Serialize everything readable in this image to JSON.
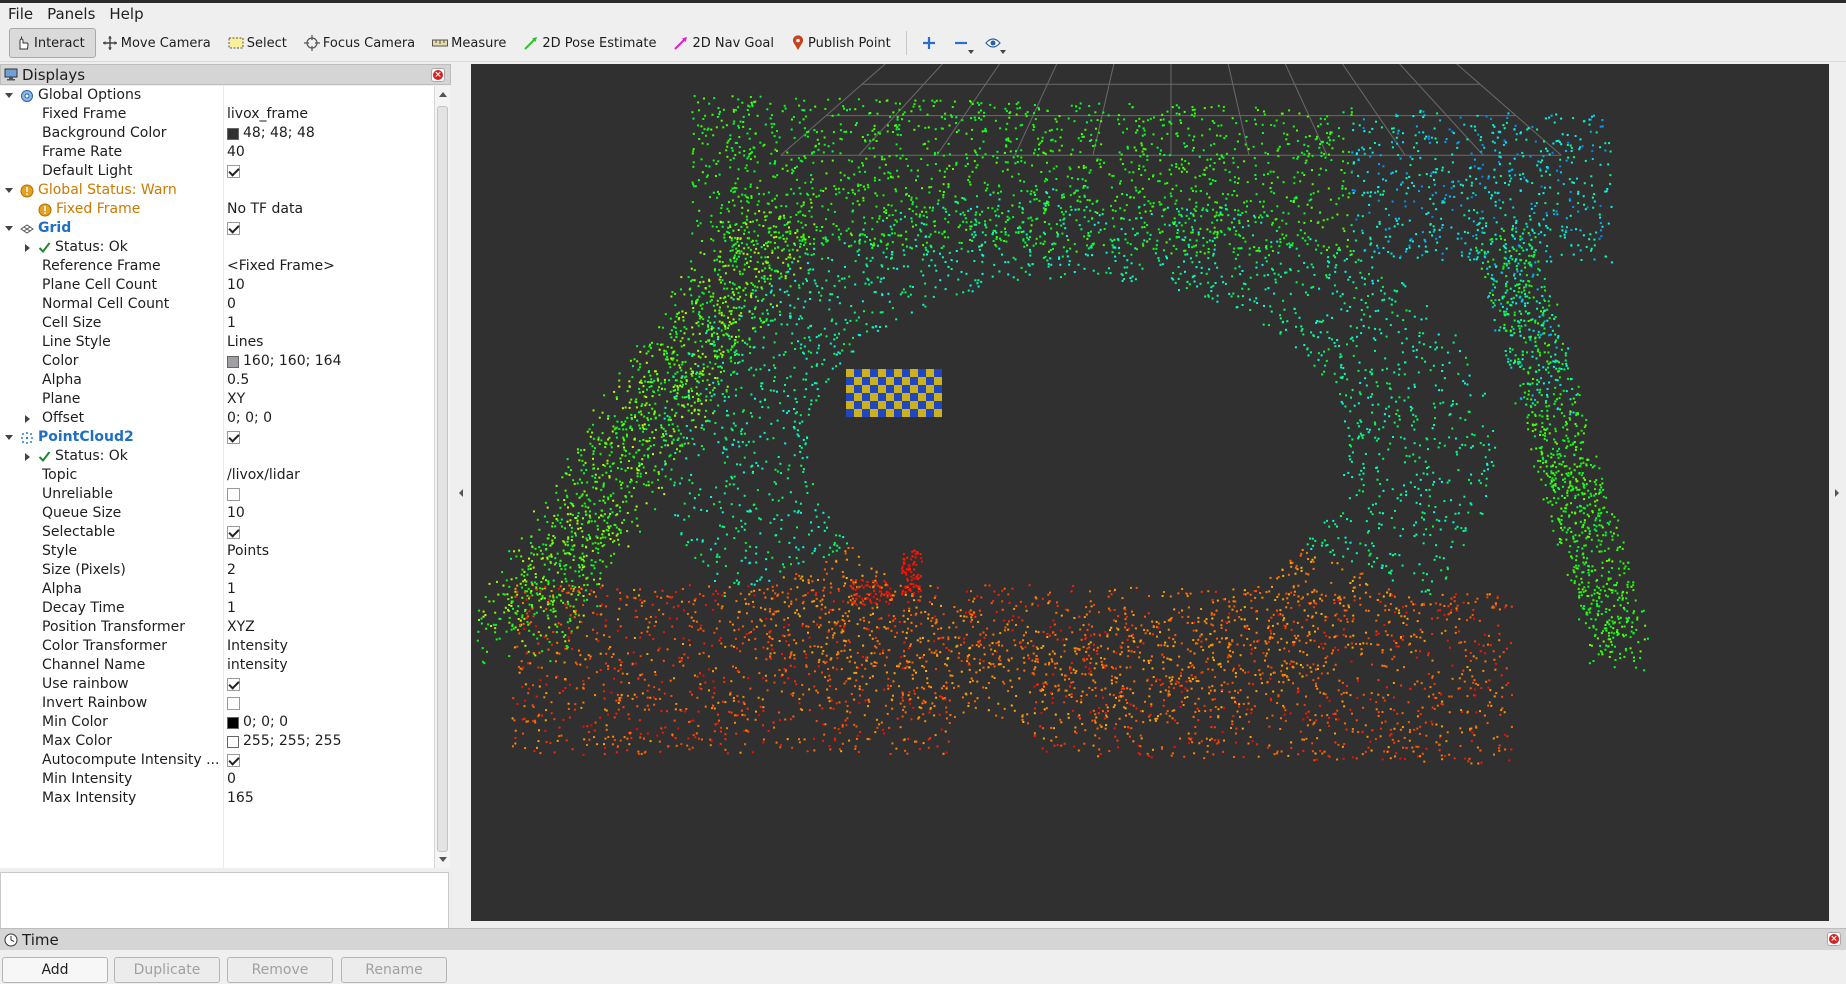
{
  "menubar": {
    "items": [
      "File",
      "Panels",
      "Help"
    ]
  },
  "toolbar": {
    "tools": [
      "Interact",
      "Move Camera",
      "Select",
      "Focus Camera",
      "Measure",
      "2D Pose Estimate",
      "2D Nav Goal",
      "Publish Point"
    ],
    "active": "Interact",
    "extra_icons": [
      "add-icon",
      "remove-icon",
      "eye-icon"
    ]
  },
  "displays_panel": {
    "title": "Displays",
    "rows": [
      {
        "depth": 0,
        "expand": "open",
        "icon": "globe-gear-icon",
        "name": "Global Options",
        "value": "",
        "style": "normal"
      },
      {
        "depth": 1,
        "name": "Fixed Frame",
        "value": "livox_frame"
      },
      {
        "depth": 1,
        "name": "Background Color",
        "value": "48; 48; 48",
        "swatch": "#303030"
      },
      {
        "depth": 1,
        "name": "Frame Rate",
        "value": "40"
      },
      {
        "depth": 1,
        "name": "Default Light",
        "check": true
      },
      {
        "depth": 0,
        "expand": "open",
        "icon": "warning-icon",
        "name": "Global Status: Warn",
        "value": "",
        "style": "warn"
      },
      {
        "depth": 1,
        "icon": "warning-icon",
        "name": "Fixed Frame",
        "value": "No TF data",
        "style": "warn"
      },
      {
        "depth": 0,
        "expand": "open",
        "icon": "grid-icon",
        "name": "Grid",
        "check": true,
        "style": "cat"
      },
      {
        "depth": 1,
        "expand": "closed",
        "icon": "ok-check-icon",
        "name": "Status: Ok",
        "value": ""
      },
      {
        "depth": 1,
        "name": "Reference Frame",
        "value": "<Fixed Frame>"
      },
      {
        "depth": 1,
        "name": "Plane Cell Count",
        "value": "10"
      },
      {
        "depth": 1,
        "name": "Normal Cell Count",
        "value": "0"
      },
      {
        "depth": 1,
        "name": "Cell Size",
        "value": "1"
      },
      {
        "depth": 1,
        "name": "Line Style",
        "value": "Lines"
      },
      {
        "depth": 1,
        "name": "Color",
        "value": "160; 160; 164",
        "swatch": "#a0a0a4"
      },
      {
        "depth": 1,
        "name": "Alpha",
        "value": "0.5"
      },
      {
        "depth": 1,
        "name": "Plane",
        "value": "XY"
      },
      {
        "depth": 1,
        "expand": "closed",
        "name": "Offset",
        "value": "0; 0; 0"
      },
      {
        "depth": 0,
        "expand": "open",
        "icon": "pointcloud-icon",
        "name": "PointCloud2",
        "check": true,
        "style": "cat"
      },
      {
        "depth": 1,
        "expand": "closed",
        "icon": "ok-check-icon",
        "name": "Status: Ok",
        "value": ""
      },
      {
        "depth": 1,
        "name": "Topic",
        "value": "/livox/lidar"
      },
      {
        "depth": 1,
        "name": "Unreliable",
        "check": false
      },
      {
        "depth": 1,
        "name": "Queue Size",
        "value": "10"
      },
      {
        "depth": 1,
        "name": "Selectable",
        "check": true
      },
      {
        "depth": 1,
        "name": "Style",
        "value": "Points"
      },
      {
        "depth": 1,
        "name": "Size (Pixels)",
        "value": "2"
      },
      {
        "depth": 1,
        "name": "Alpha",
        "value": "1"
      },
      {
        "depth": 1,
        "name": "Decay Time",
        "value": "1"
      },
      {
        "depth": 1,
        "name": "Position Transformer",
        "value": "XYZ"
      },
      {
        "depth": 1,
        "name": "Color Transformer",
        "value": "Intensity"
      },
      {
        "depth": 1,
        "name": "Channel Name",
        "value": "intensity"
      },
      {
        "depth": 1,
        "name": "Use rainbow",
        "check": true
      },
      {
        "depth": 1,
        "name": "Invert Rainbow",
        "check": false
      },
      {
        "depth": 1,
        "name": "Min Color",
        "value": "0; 0; 0",
        "swatch": "#000000"
      },
      {
        "depth": 1,
        "name": "Max Color",
        "value": "255; 255; 255",
        "swatch": "#ffffff"
      },
      {
        "depth": 1,
        "name": "Autocompute Intensity ...",
        "check": true
      },
      {
        "depth": 1,
        "name": "Min Intensity",
        "value": "0"
      },
      {
        "depth": 1,
        "name": "Max Intensity",
        "value": "165"
      }
    ],
    "buttons": [
      {
        "label": "Add",
        "enabled": true
      },
      {
        "label": "Duplicate",
        "enabled": false
      },
      {
        "label": "Remove",
        "enabled": false
      },
      {
        "label": "Rename",
        "enabled": false
      }
    ]
  },
  "time_panel": {
    "title": "Time"
  },
  "colors": {
    "warn": "#cc7a00",
    "category": "#1f6fc4",
    "viewport_bg": "#303030",
    "grid": "#a0a0a4"
  }
}
